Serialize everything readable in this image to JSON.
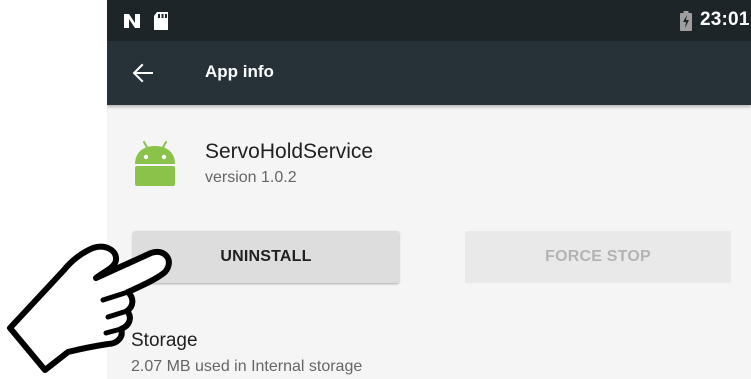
{
  "statusbar": {
    "time": "23:01",
    "icons": [
      "nfc-icon",
      "sd-card-icon",
      "battery-charging-icon"
    ]
  },
  "appbar": {
    "title": "App info",
    "back_icon": "arrow-back-icon"
  },
  "app": {
    "name": "ServoHoldService",
    "version": "version 1.0.2",
    "icon": "android-icon",
    "icon_color": "#8bc34a"
  },
  "buttons": {
    "uninstall": "UNINSTALL",
    "force_stop": "FORCE STOP"
  },
  "storage": {
    "title": "Storage",
    "summary": "2.07 MB used in Internal storage"
  },
  "colors": {
    "statusbar": "#1d2528",
    "appbar": "#263238",
    "background": "#f5f5f5"
  },
  "overlay": {
    "icon": "pointing-hand-icon"
  }
}
